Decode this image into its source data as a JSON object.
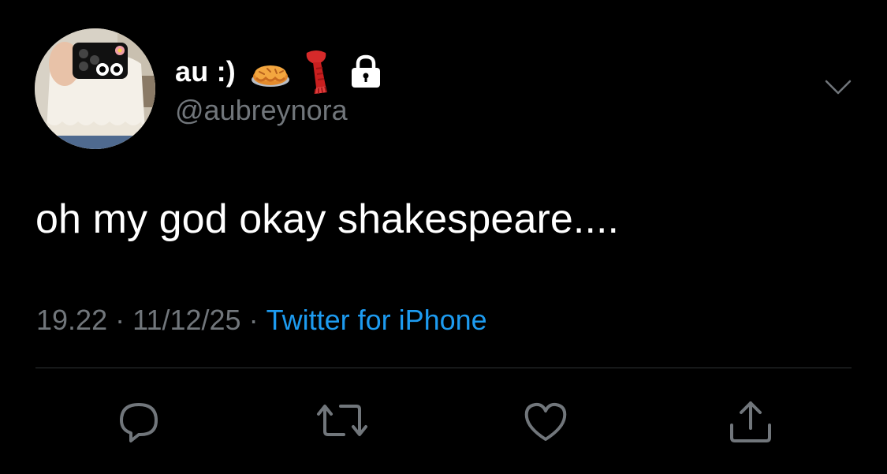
{
  "author": {
    "display_name": "au :)",
    "handle": "@aubreynora",
    "badges": [
      "pie-emoji",
      "scarf-emoji",
      "lock-icon"
    ]
  },
  "tweet": {
    "text": "oh my god okay shakespeare....",
    "time": "19.22",
    "separator": "·",
    "date": "11/12/25",
    "source": "Twitter for iPhone"
  },
  "actions": [
    "reply-icon",
    "retweet-icon",
    "like-icon",
    "share-icon"
  ],
  "colors": {
    "background": "#000000",
    "text_primary": "#ffffff",
    "text_secondary": "#71767b",
    "link": "#1d9bf0",
    "divider": "#2f3336",
    "icon": "#71767b"
  }
}
